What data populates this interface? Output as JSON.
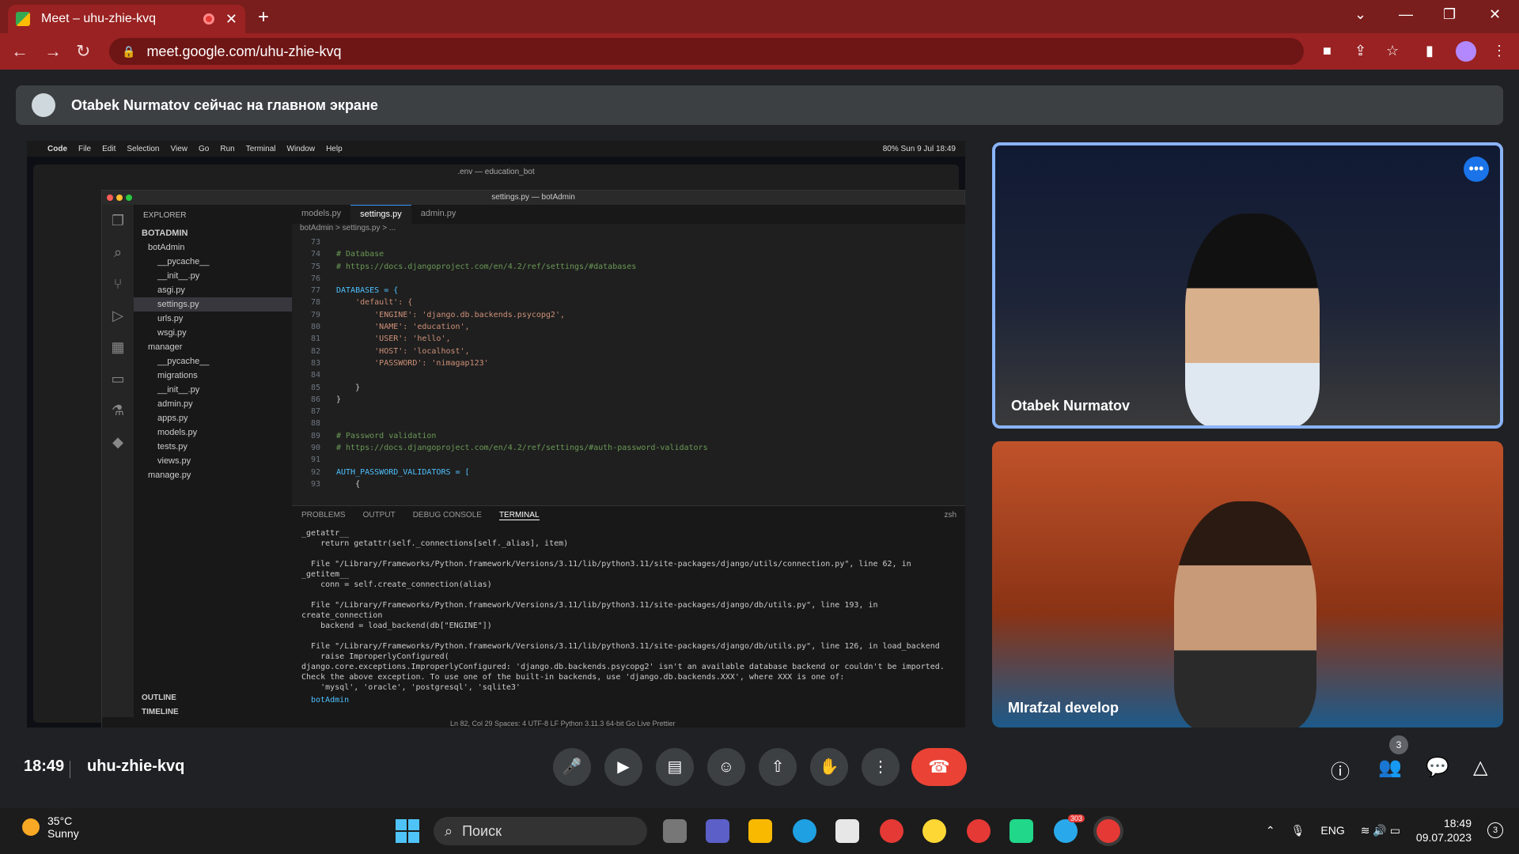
{
  "browser": {
    "tab_title": "Meet – uhu-zhie-kvq",
    "tab_close": "✕",
    "new_tab": "+",
    "url": "meet.google.com/uhu-zhie-kvq"
  },
  "banner": {
    "text": "Otabek Nurmatov сейчас на главном экране"
  },
  "shared_screen": {
    "mac_menu": [
      "Code",
      "File",
      "Edit",
      "Selection",
      "View",
      "Go",
      "Run",
      "Terminal",
      "Window",
      "Help"
    ],
    "mac_status": "80%   Sun 9 Jul 18:49",
    "bg_window_title": ".env — education_bot",
    "window_title": "settings.py — botAdmin",
    "explorer_title": "EXPLORER",
    "tree": {
      "root": "BOTADMIN",
      "items": [
        "botAdmin",
        "__pycache__",
        "__init__.py",
        "asgi.py",
        "settings.py",
        "urls.py",
        "wsgi.py",
        "manager",
        "__pycache__",
        "migrations",
        "__init__.py",
        "admin.py",
        "apps.py",
        "models.py",
        "tests.py",
        "views.py",
        "manage.py"
      ],
      "outline": "OUTLINE",
      "timeline": "TIMELINE"
    },
    "editor_tabs": [
      "models.py",
      "settings.py",
      "admin.py"
    ],
    "breadcrumb": "botAdmin > settings.py > ...",
    "code_lines": [
      {
        "n": "73",
        "t": ""
      },
      {
        "n": "74",
        "t": "# Database"
      },
      {
        "n": "75",
        "t": "# https://docs.djangoproject.com/en/4.2/ref/settings/#databases"
      },
      {
        "n": "76",
        "t": ""
      },
      {
        "n": "77",
        "t": "DATABASES = {"
      },
      {
        "n": "78",
        "t": "    'default': {"
      },
      {
        "n": "79",
        "t": "        'ENGINE': 'django.db.backends.psycopg2',"
      },
      {
        "n": "80",
        "t": "        'NAME': 'education',"
      },
      {
        "n": "81",
        "t": "        'USER': 'hello',"
      },
      {
        "n": "82",
        "t": "        'HOST': 'localhost',"
      },
      {
        "n": "83",
        "t": "        'PASSWORD': 'nimagap123'"
      },
      {
        "n": "84",
        "t": ""
      },
      {
        "n": "85",
        "t": "    }"
      },
      {
        "n": "86",
        "t": "}"
      },
      {
        "n": "87",
        "t": ""
      },
      {
        "n": "88",
        "t": ""
      },
      {
        "n": "89",
        "t": "# Password validation"
      },
      {
        "n": "90",
        "t": "# https://docs.djangoproject.com/en/4.2/ref/settings/#auth-password-validators"
      },
      {
        "n": "91",
        "t": ""
      },
      {
        "n": "92",
        "t": "AUTH_PASSWORD_VALIDATORS = ["
      },
      {
        "n": "93",
        "t": "    {"
      }
    ],
    "terminal_tabs": [
      "PROBLEMS",
      "OUTPUT",
      "DEBUG CONSOLE",
      "TERMINAL"
    ],
    "terminal_shell": "zsh",
    "terminal_output": "_getattr__\n    return getattr(self._connections[self._alias], item)\n\n  File \"/Library/Frameworks/Python.framework/Versions/3.11/lib/python3.11/site-packages/django/utils/connection.py\", line 62, in _getitem__\n    conn = self.create_connection(alias)\n\n  File \"/Library/Frameworks/Python.framework/Versions/3.11/lib/python3.11/site-packages/django/db/utils.py\", line 193, in create_connection\n    backend = load_backend(db[\"ENGINE\"])\n\n  File \"/Library/Frameworks/Python.framework/Versions/3.11/lib/python3.11/site-packages/django/db/utils.py\", line 126, in load_backend\n    raise ImproperlyConfigured(\ndjango.core.exceptions.ImproperlyConfigured: 'django.db.backends.psycopg2' isn't an available database backend or couldn't be imported. Check the above exception. To use one of the built-in backends, use 'django.db.backends.XXX', where XXX is one of:\n    'mysql', 'oracle', 'postgresql', 'sqlite3'",
    "prompt": "botAdmin",
    "status_bar": "Ln 82, Col 29   Spaces: 4   UTF-8   LF   Python   3.11.3 64-bit   Go Live   Prettier"
  },
  "participants": [
    {
      "name": "Otabek Nurmatov"
    },
    {
      "name": "MIrafzal develop"
    }
  ],
  "controls": {
    "time": "18:49",
    "meeting_code": "uhu-zhie-kvq",
    "participant_count": "3"
  },
  "taskbar": {
    "temperature": "35°C",
    "weather": "Sunny",
    "search_label": "Поиск",
    "lang": "ENG",
    "time": "18:49",
    "date": "09.07.2023",
    "notifications": "3",
    "telegram_badge": "303"
  },
  "colors": {
    "chrome_frame": "#9a2222",
    "meet_bg": "#202124",
    "hangup": "#ea4335",
    "active_speaker_border": "#8ab4f8"
  }
}
